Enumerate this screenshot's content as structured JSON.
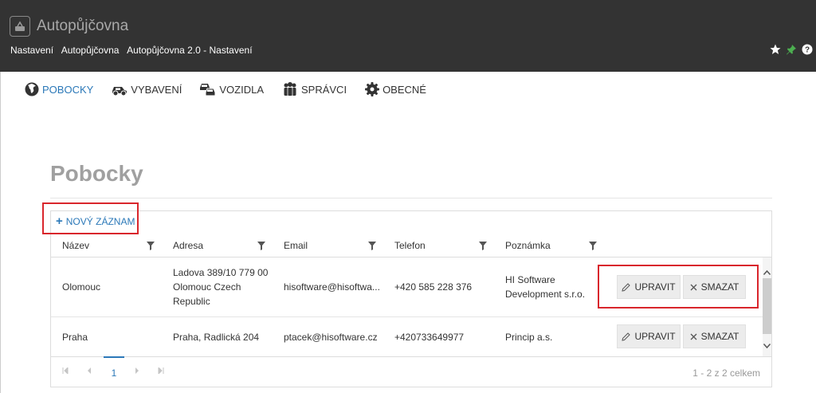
{
  "header": {
    "app_title": "Autopůjčovna",
    "breadcrumb": [
      "Nastavení",
      "Autopůjčovna",
      "Autopůjčovna 2.0 - Nastavení"
    ]
  },
  "nav": {
    "items": [
      {
        "label": "POBOCKY",
        "icon": "globe-icon",
        "active": true
      },
      {
        "label": "VYBAVENÍ",
        "icon": "car-wheel-icon",
        "active": false
      },
      {
        "label": "VOZIDLA",
        "icon": "cars-icon",
        "active": false
      },
      {
        "label": "SPRÁVCI",
        "icon": "users-icon",
        "active": false
      },
      {
        "label": "OBECNÉ",
        "icon": "gear-icon",
        "active": false
      }
    ]
  },
  "page": {
    "title": "Pobocky"
  },
  "grid": {
    "new_record_label": "NOVÝ ZÁZNAM",
    "columns": [
      "Název",
      "Adresa",
      "Email",
      "Telefon",
      "Poznámka"
    ],
    "rows": [
      {
        "name": "Olomouc",
        "address": [
          "Ladova 389/10 779 00",
          "Olomouc Czech",
          "Republic"
        ],
        "email": "hisoftware@hisoftwa...",
        "phone": "+420 585 228 376",
        "note": [
          "HI Software",
          "Development s.r.o."
        ]
      },
      {
        "name": "Praha",
        "address": [
          "Praha, Radlická 204"
        ],
        "email": "ptacek@hisoftware.cz",
        "phone": "+420733649977",
        "note": [
          "Princip a.s."
        ]
      }
    ],
    "edit_label": "UPRAVIT",
    "delete_label": "SMAZAT",
    "pager": {
      "current_page": "1",
      "info": "1 - 2 z 2 celkem"
    }
  },
  "colors": {
    "header_bg": "#333333",
    "accent": "#2b78b8",
    "highlight": "#d9262c"
  }
}
